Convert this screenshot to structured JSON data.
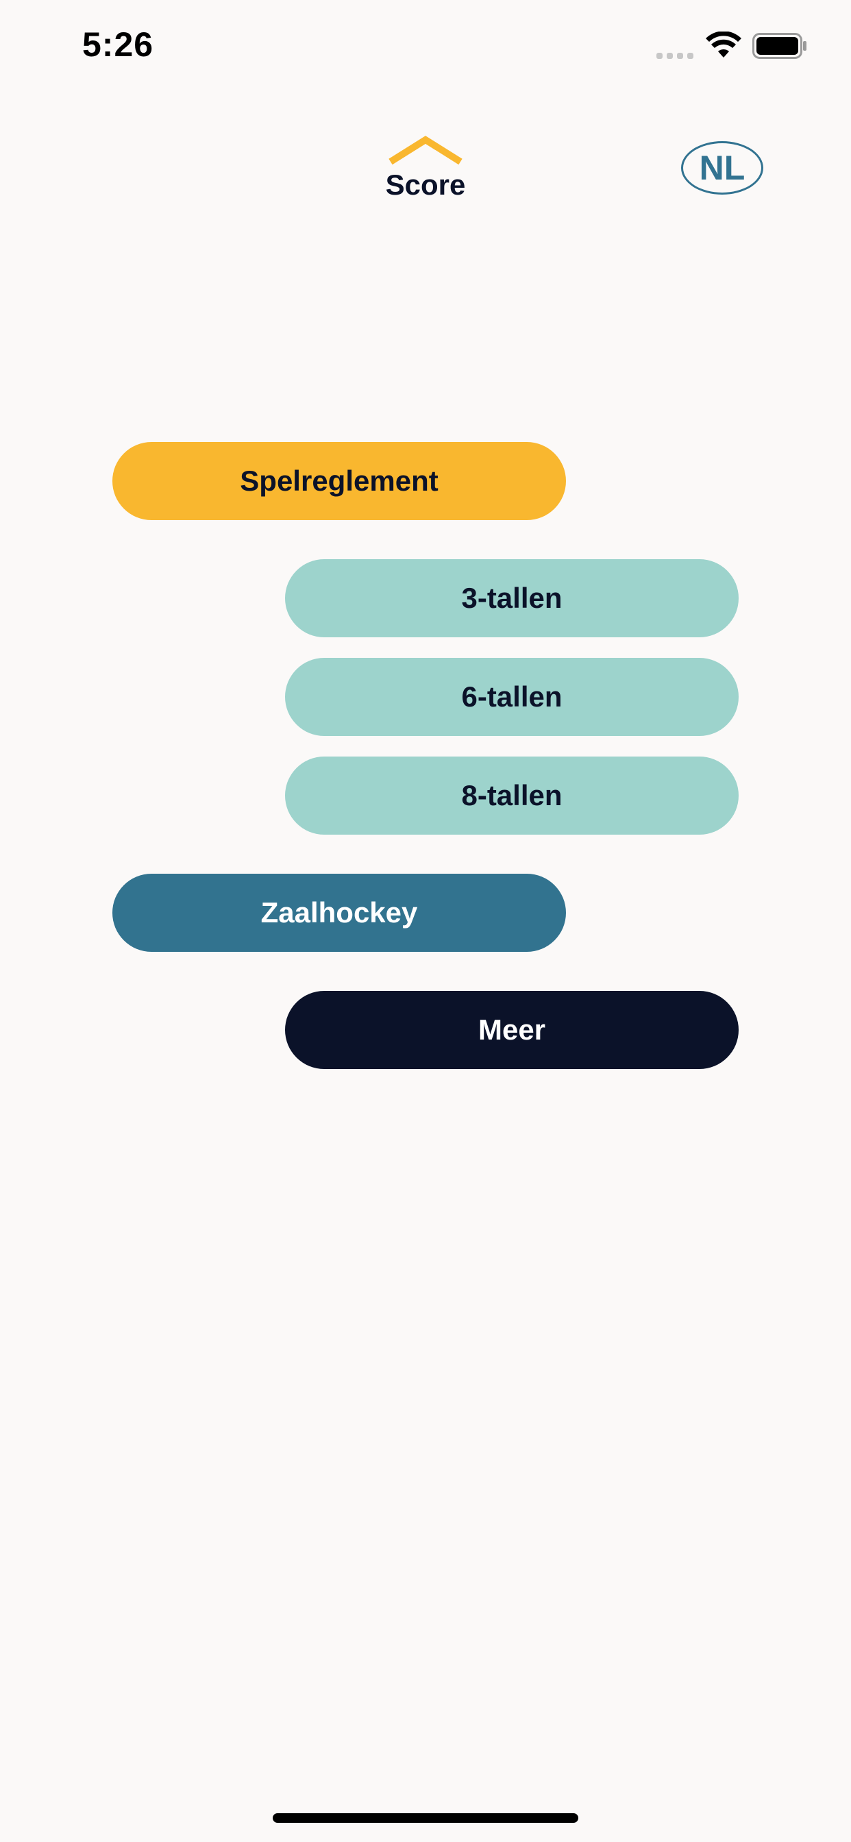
{
  "status_bar": {
    "time": "5:26",
    "wifi_icon": "wifi-icon",
    "battery_icon": "battery-icon"
  },
  "header": {
    "logo_icon": "chevron-up-icon",
    "title": "Score",
    "language": "NL"
  },
  "menu": {
    "spelreglement": "Spelreglement",
    "drietallen": "3-tallen",
    "zestallen": "6-tallen",
    "achttallen": "8-tallen",
    "zaalhockey": "Zaalhockey",
    "meer": "Meer"
  },
  "colors": {
    "background": "#fbf9f8",
    "yellow": "#f9b72f",
    "mint": "#9dd3cc",
    "teal": "#32738f",
    "navy": "#0b1229"
  }
}
